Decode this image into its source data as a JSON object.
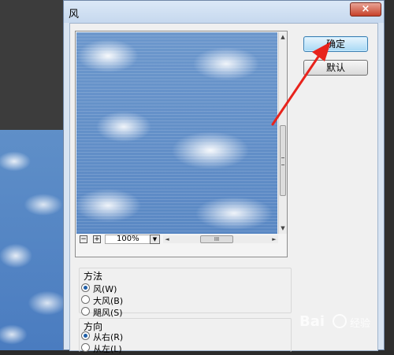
{
  "dialog": {
    "title": "风",
    "close_symbol": "×"
  },
  "buttons": {
    "ok_label": "确定",
    "default_label": "默认"
  },
  "preview": {
    "zoom_value": "100%",
    "zoom_out_symbol": "−",
    "zoom_in_symbol": "+",
    "dropdown_symbol": "▼",
    "scroll_up": "▲",
    "scroll_down": "▼",
    "scroll_left": "◄",
    "scroll_right": "►",
    "hthumb_grip": "III"
  },
  "method_group": {
    "title": "方法",
    "options": [
      {
        "label": "风(W)",
        "checked": true
      },
      {
        "label": "大风(B)",
        "checked": false
      },
      {
        "label": "飓风(S)",
        "checked": false
      }
    ]
  },
  "direction_group": {
    "title": "方向",
    "options": [
      {
        "label": "从右(R)",
        "checked": true
      },
      {
        "label": "从左(L)",
        "checked": false
      }
    ]
  },
  "annotation": {
    "arrow_color": "#e8231c"
  },
  "watermark": {
    "text": "Bai",
    "sub": "经验"
  }
}
